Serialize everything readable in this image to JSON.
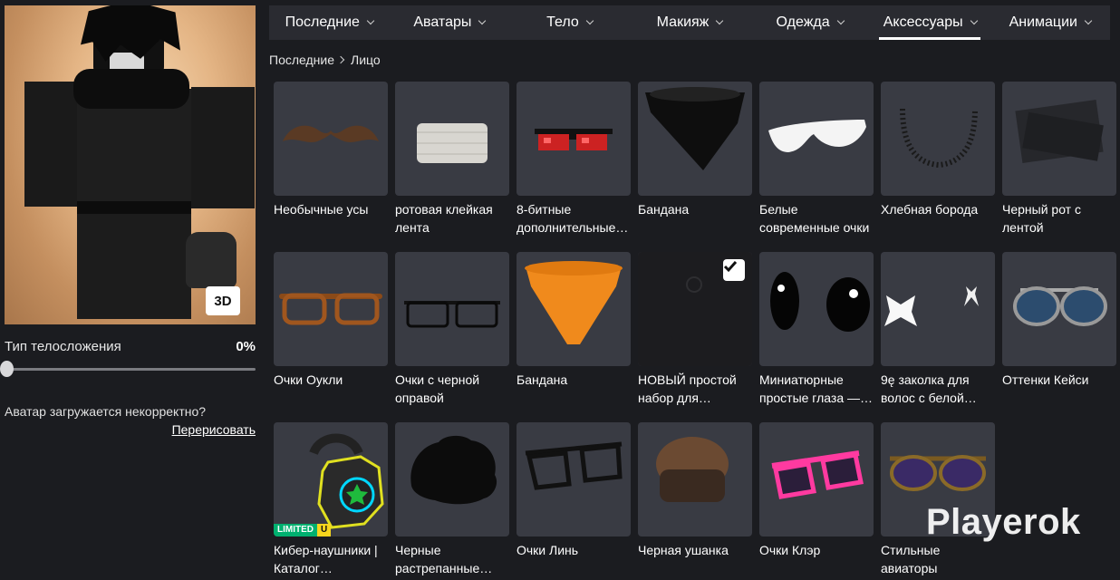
{
  "tabs": [
    {
      "label": "Последние",
      "active": false
    },
    {
      "label": "Аватары",
      "active": false
    },
    {
      "label": "Тело",
      "active": false
    },
    {
      "label": "Макияж",
      "active": false
    },
    {
      "label": "Одежда",
      "active": false
    },
    {
      "label": "Аксессуары",
      "active": true
    },
    {
      "label": "Анимации",
      "active": false
    }
  ],
  "breadcrumb": {
    "parent": "Последние",
    "current": "Лицо"
  },
  "avatar": {
    "view_button": "3D"
  },
  "body_type": {
    "label": "Тип телосложения",
    "value": "0%"
  },
  "avatar_issue": {
    "text": "Аватар загружается некорректно?",
    "link": "Перерисовать"
  },
  "items": [
    {
      "name": "Необычные усы",
      "icon": "mustache-icon"
    },
    {
      "name": "ротовая клейкая лента",
      "icon": "tape-icon"
    },
    {
      "name": "8-битные дополнительные…",
      "icon": "pixel-glasses-icon"
    },
    {
      "name": "Бандана",
      "icon": "black-bandana-icon"
    },
    {
      "name": "Белые современные очки",
      "icon": "white-glasses-icon"
    },
    {
      "name": "Хлебная борода",
      "icon": "beard-icon"
    },
    {
      "name": "Черный рот с лентой",
      "icon": "black-tape-icon"
    },
    {
      "name": "Очки Оукли",
      "icon": "brown-glasses-icon"
    },
    {
      "name": "Очки с черной оправой",
      "icon": "black-frame-glasses-icon"
    },
    {
      "name": "Бандана",
      "icon": "orange-bandana-icon"
    },
    {
      "name": "НОВЫЙ простой набор для…",
      "icon": "dark-set-icon",
      "selected": true
    },
    {
      "name": "Миниатюрные простые глаза —…",
      "icon": "eyes-icon"
    },
    {
      "name": "9ę заколка для волос с белой…",
      "icon": "bow-icon"
    },
    {
      "name": "Оттенки Кейси",
      "icon": "aviator-blue-icon"
    },
    {
      "name": "Кибер-наушники | Каталог создател…",
      "icon": "cyber-headphones-icon",
      "badge": {
        "limited": "LIMITED",
        "u": "U"
      }
    },
    {
      "name": "Черные растрепанные…",
      "icon": "messy-hair-icon"
    },
    {
      "name": "Очки Линь",
      "icon": "linh-glasses-icon"
    },
    {
      "name": "Черная ушанка",
      "icon": "ushanka-icon"
    },
    {
      "name": "Очки Клэр",
      "icon": "pink-glasses-icon"
    },
    {
      "name": "Стильные авиаторы",
      "icon": "aviator-gold-icon"
    }
  ],
  "watermark": "Playerok"
}
